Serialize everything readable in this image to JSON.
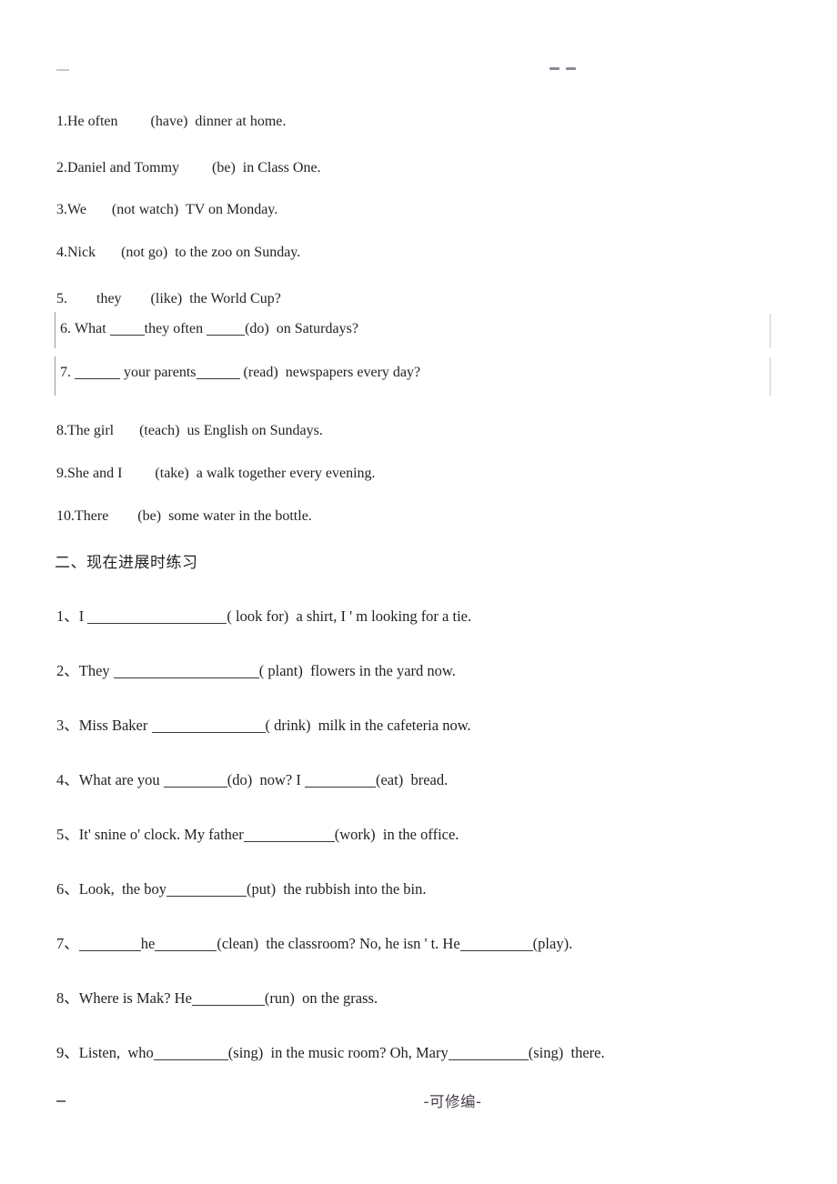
{
  "header": {
    "left_mark": "",
    "center_marks": [
      "",
      ""
    ]
  },
  "footer": {
    "left_dash": "",
    "text": "-可修编-"
  },
  "section1": {
    "items": [
      {
        "num": "1.",
        "text": "He often         (have)  dinner at home."
      },
      {
        "num": "2.",
        "text": "Daniel and Tommy         (be)  in Class One."
      },
      {
        "num": "3.",
        "text": "We       (not watch)  TV on Monday."
      },
      {
        "num": "4.",
        "text": "Nick       (not go)  to the zoo on Sunday."
      },
      {
        "num": "5.",
        "text": "        they        (like)  the World Cup?"
      },
      {
        "num": "6.",
        "prefix": "What ",
        "mid": "they often ",
        "suffix": "(do)  on Saturdays?"
      },
      {
        "num": "7.",
        "prefix": "",
        "mid": " your parents",
        "suffix": " (read)  newspapers every day?"
      },
      {
        "num": "8.",
        "text": "The girl       (teach)  us English on Sundays."
      },
      {
        "num": "9.",
        "text": "She and I         (take)  a walk together every evening."
      },
      {
        "num": "10.",
        "text": "There        (be)  some water in the bottle."
      }
    ]
  },
  "section2": {
    "heading": "二、现在进展时练习",
    "items": [
      {
        "num": "1、",
        "before": "I ",
        "after": "( look for)  a shirt, I ' m looking for a tie."
      },
      {
        "num": "2、",
        "before": "They ",
        "after": "( plant)  flowers in the yard now."
      },
      {
        "num": "3、",
        "before": "Miss Baker ",
        "after": "( drink)  milk in the cafeteria now."
      },
      {
        "num": "4、",
        "before": "What are you ",
        "after": "(do)  now? I ",
        "after2": "(eat)  bread."
      },
      {
        "num": "5、",
        "before": "It' snine o' clock. My father",
        "after": "(work)  in the office."
      },
      {
        "num": "6、",
        "before": "Look,  the boy",
        "after": "(put)  the rubbish into the bin."
      },
      {
        "num": "7、",
        "before": "",
        "mid": "he",
        "after": "(clean)  the classroom? No, he isn ' t. He",
        "after2": "(play)."
      },
      {
        "num": "8、",
        "before": "Where is Mak? He",
        "after": "(run)  on the grass."
      },
      {
        "num": "9、",
        "before": "Listen,  who",
        "after": "(sing)  in the music room? Oh, Mary",
        "after2": "(sing)  there."
      }
    ]
  }
}
